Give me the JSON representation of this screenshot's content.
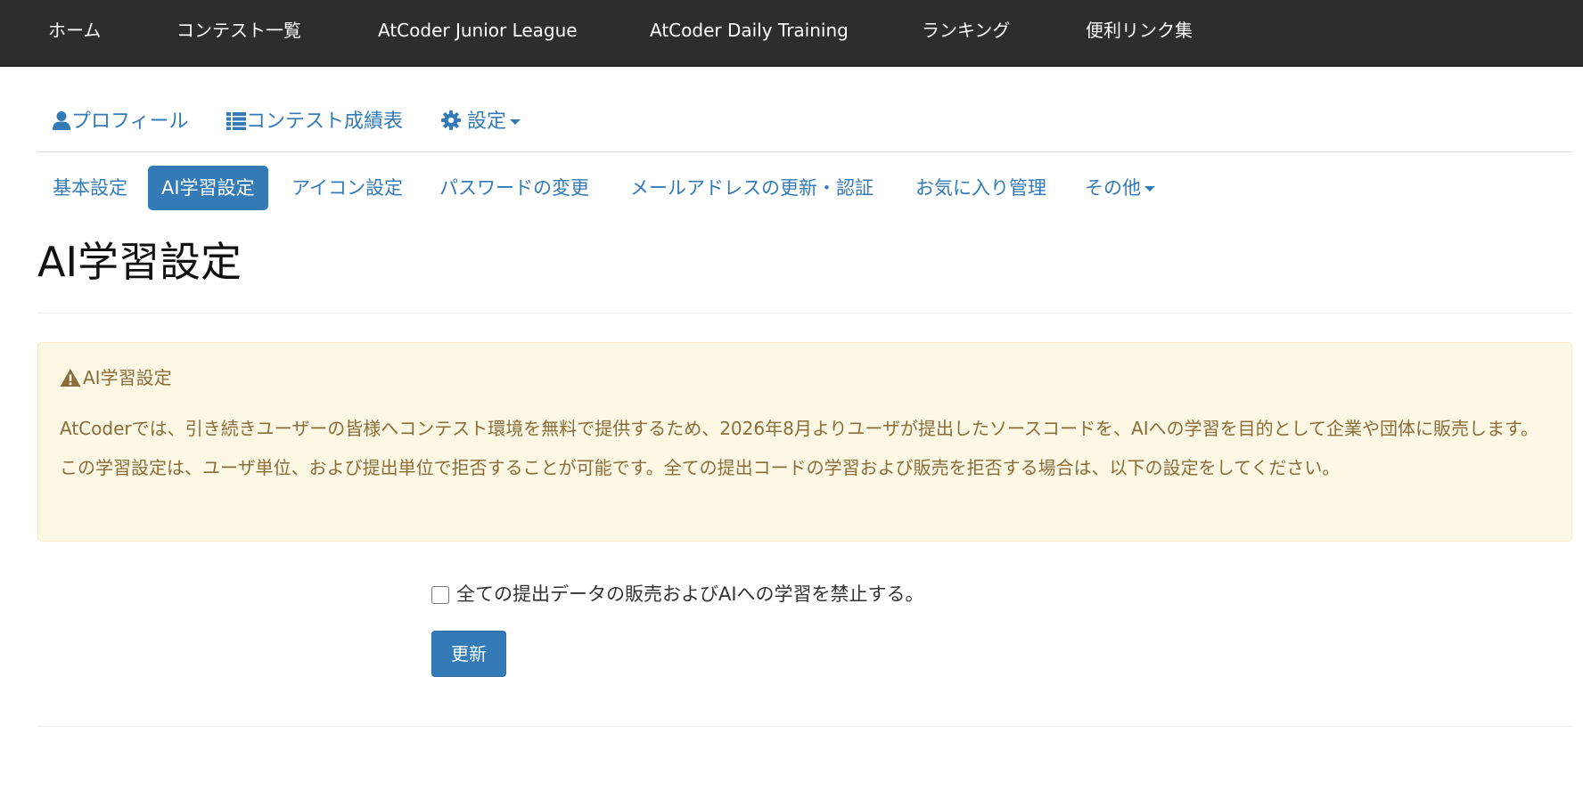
{
  "topnav": {
    "items": [
      {
        "label": "ホーム"
      },
      {
        "label": "コンテスト一覧"
      },
      {
        "label": "AtCoder Junior League"
      },
      {
        "label": "AtCoder Daily Training"
      },
      {
        "label": "ランキング"
      },
      {
        "label": "便利リンク集"
      }
    ]
  },
  "profile_tabs": {
    "profile": "プロフィール",
    "results": "コンテスト成績表",
    "settings": "設定"
  },
  "settings_pills": {
    "items": [
      {
        "label": "基本設定"
      },
      {
        "label": "AI学習設定",
        "active": true
      },
      {
        "label": "アイコン設定"
      },
      {
        "label": "パスワードの変更"
      },
      {
        "label": "メールアドレスの更新・認証"
      },
      {
        "label": "お気に入り管理"
      },
      {
        "label": "その他"
      }
    ]
  },
  "page": {
    "title": "AI学習設定"
  },
  "alert": {
    "title": "AI学習設定",
    "body": "AtCoderでは、引き続きユーザーの皆様へコンテスト環境を無料で提供するため、2026年8月よりユーザが提出したソースコードを、AIへの学習を目的として企業や団体に販売します。この学習設定は、ユーザ単位、および提出単位で拒否することが可能です。全ての提出コードの学習および販売を拒否する場合は、以下の設定をしてください。"
  },
  "form": {
    "checkbox_label": "全ての提出データの販売およびAIへの学習を禁止する。",
    "checkbox_checked": false,
    "submit_label": "更新"
  },
  "colors": {
    "navbar_bg": "#2d2d2d",
    "link": "#337ab7",
    "primary": "#337ab7",
    "warning_bg": "#fcf8e3",
    "warning_border": "#faebcc",
    "warning_text": "#8a6d3b"
  }
}
